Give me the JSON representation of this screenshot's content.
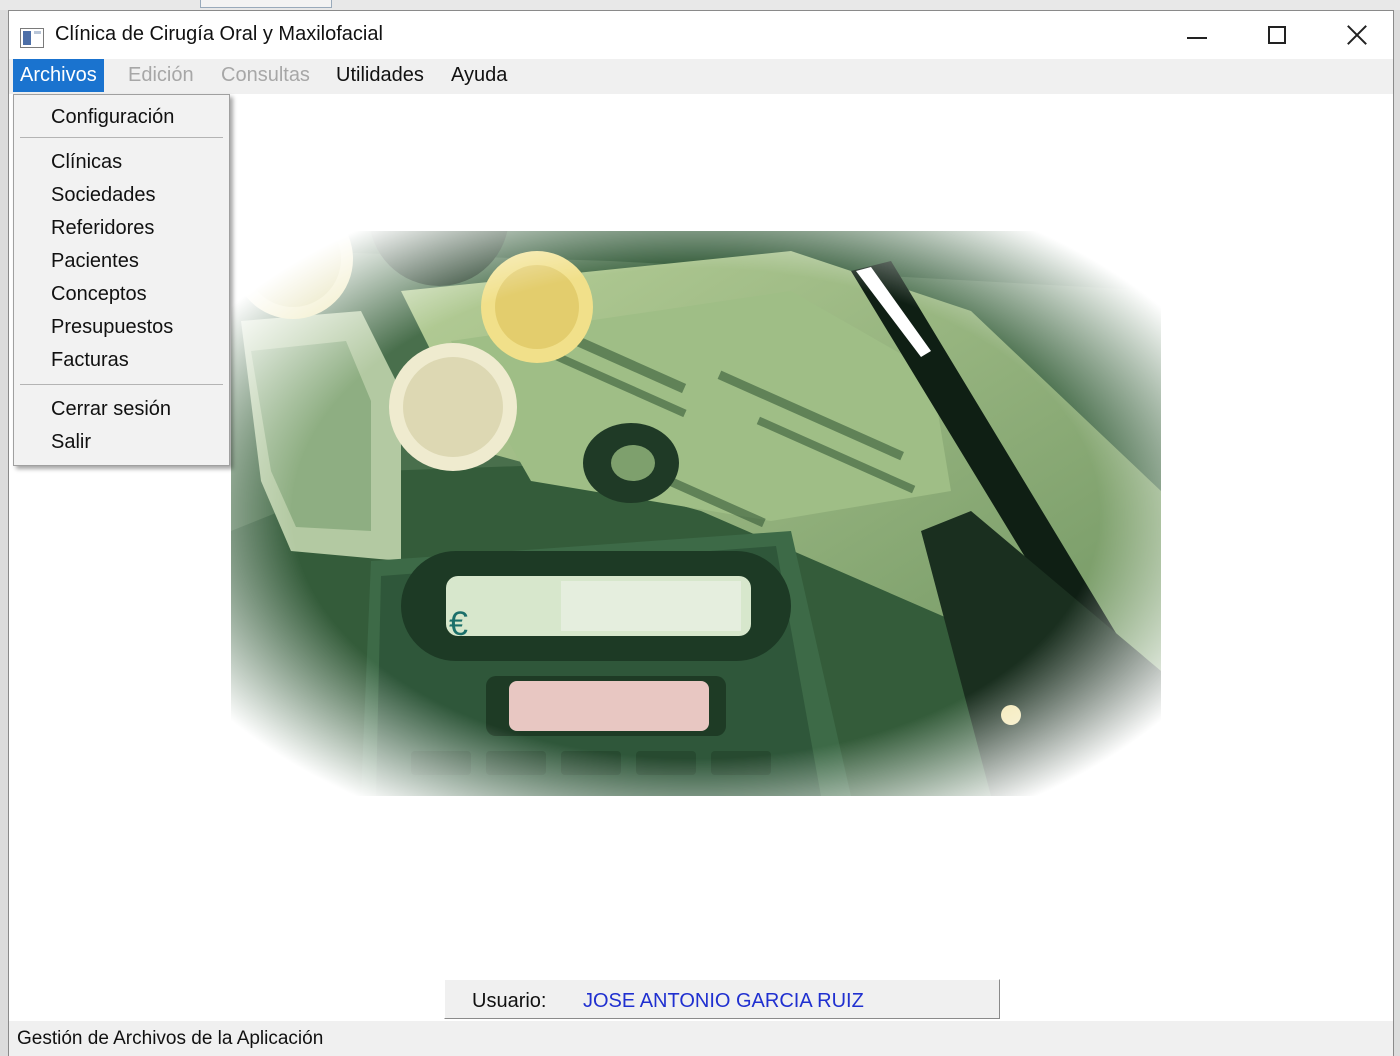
{
  "window": {
    "title": "Clínica de Cirugía Oral y Maxilofacial"
  },
  "menubar": {
    "items": [
      {
        "label": "Archivos",
        "state": "active"
      },
      {
        "label": "Edición",
        "state": "disabled"
      },
      {
        "label": "Consultas",
        "state": "disabled"
      },
      {
        "label": "Utilidades",
        "state": "enabled"
      },
      {
        "label": "Ayuda",
        "state": "enabled"
      }
    ]
  },
  "dropdown": {
    "items": [
      {
        "label": "Configuración"
      },
      {
        "label": "Clínicas"
      },
      {
        "label": "Sociedades"
      },
      {
        "label": "Referidores"
      },
      {
        "label": "Pacientes"
      },
      {
        "label": "Conceptos"
      },
      {
        "label": "Presupuestos"
      },
      {
        "label": "Facturas"
      },
      {
        "label": "Cerrar sesión"
      },
      {
        "label": "Salir"
      }
    ]
  },
  "photo": {
    "currency_symbol": "€"
  },
  "user_panel": {
    "label": "Usuario:",
    "value": "JOSE ANTONIO GARCIA RUIZ"
  },
  "statusbar": {
    "text": "Gestión de Archivos de la Aplicación"
  },
  "colors": {
    "menu_active_bg": "#1a73cf",
    "user_value": "#2030d0",
    "photo_dark_green": "#1f3a26",
    "photo_light_green": "#c9d9a8"
  },
  "icons": {
    "app": "app-window-icon",
    "minimize": "minimize-icon",
    "maximize": "maximize-icon",
    "close": "close-icon"
  }
}
